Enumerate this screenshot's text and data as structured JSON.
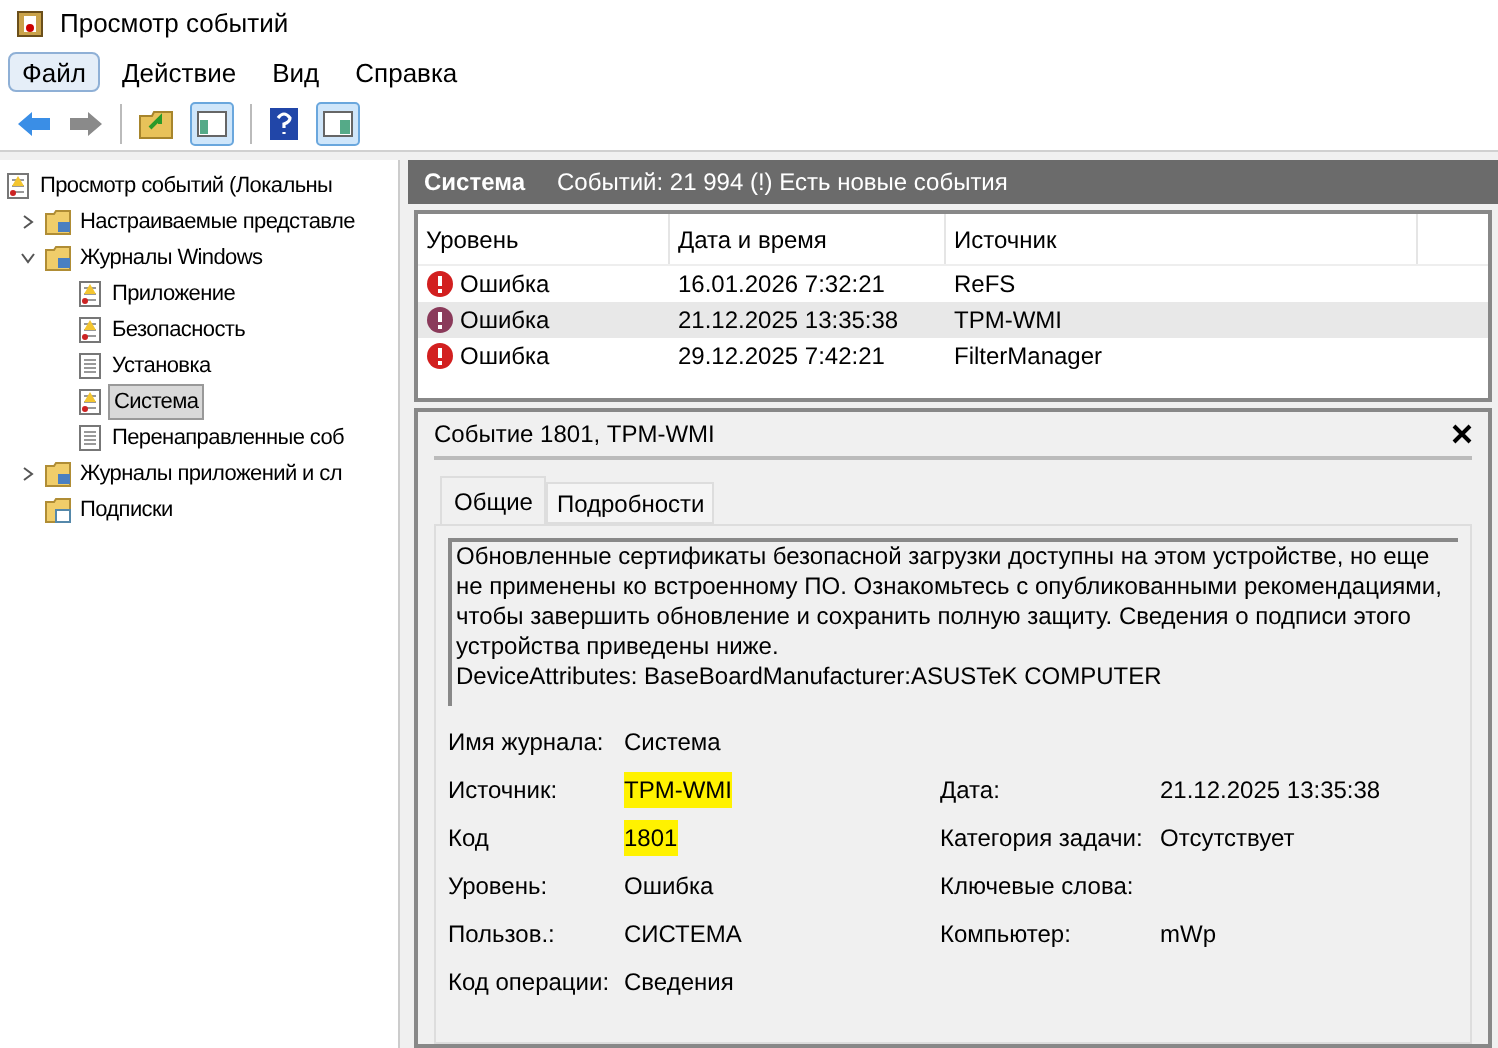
{
  "window": {
    "title": "Просмотр событий"
  },
  "menu": [
    {
      "label": "Файл",
      "selected": true
    },
    {
      "label": "Действие",
      "selected": false
    },
    {
      "label": "Вид",
      "selected": false
    },
    {
      "label": "Справка",
      "selected": false
    }
  ],
  "tree": [
    {
      "label": "Просмотр событий (Локальны",
      "kind": "root",
      "selected": false,
      "children": [
        {
          "label": "Настраиваемые представле",
          "kind": "folder",
          "expanded": false,
          "selected": false
        },
        {
          "label": "Журналы Windows",
          "kind": "folder",
          "expanded": true,
          "selected": false,
          "children": [
            {
              "label": "Приложение",
              "kind": "log",
              "selected": false
            },
            {
              "label": "Безопасность",
              "kind": "log",
              "selected": false
            },
            {
              "label": "Установка",
              "kind": "plain",
              "selected": false
            },
            {
              "label": "Система",
              "kind": "log",
              "selected": true
            },
            {
              "label": "Перенаправленные соб",
              "kind": "plain",
              "selected": false
            }
          ]
        },
        {
          "label": "Журналы приложений и сл",
          "kind": "folder",
          "expanded": false,
          "selected": false
        },
        {
          "label": "Подписки",
          "kind": "subs",
          "selected": false
        }
      ]
    }
  ],
  "log_header": {
    "title": "Система",
    "summary": "Событий: 21 994 (!) Есть новые события"
  },
  "table": {
    "columns": [
      "Уровень",
      "Дата и время",
      "Источник"
    ],
    "rows": [
      {
        "level": "Ошибка",
        "date": "16.01.2026 7:32:21",
        "source": "ReFS",
        "selected": false
      },
      {
        "level": "Ошибка",
        "date": "21.12.2025 13:35:38",
        "source": "TPM-WMI",
        "selected": true
      },
      {
        "level": "Ошибка",
        "date": "29.12.2025 7:42:21",
        "source": "FilterManager",
        "selected": false
      }
    ]
  },
  "event": {
    "title": "Событие 1801, TPM-WMI",
    "tabs": [
      {
        "label": "Общие",
        "selected": true
      },
      {
        "label": "Подробности",
        "selected": false
      }
    ],
    "description": [
      "Обновленные сертификаты безопасной загрузки доступны на этом устройстве, но еще не применены ко встроенному ПО. Ознакомьтесь с опубликованными рекомендациями, чтобы завершить обновление и сохранить полную защиту. Сведения о подписи этого устройства приведены ниже.",
      "DeviceAttributes: BaseBoardManufacturer:ASUSTeK COMPUTER"
    ],
    "fields": [
      [
        {
          "label": "Имя журнала:",
          "value": "Система"
        }
      ],
      [
        {
          "label": "Источник:",
          "value": "TPM-WMI",
          "highlighted": true
        },
        {
          "label": "Дата:",
          "value": "21.12.2025 13:35:38"
        }
      ],
      [
        {
          "label": "Код",
          "value": "1801",
          "highlighted": true
        },
        {
          "label": "Категория задачи:",
          "value": "Отсутствует"
        }
      ],
      [
        {
          "label": "Уровень:",
          "value": "Ошибка"
        },
        {
          "label": "Ключевые слова:"
        }
      ],
      [
        {
          "label": "Пользов.:",
          "value": "СИСТЕМА"
        },
        {
          "label": "Компьютер:",
          "value": "mWp"
        }
      ],
      [
        {
          "label": "Код операции:",
          "value": "Сведения"
        }
      ]
    ]
  }
}
